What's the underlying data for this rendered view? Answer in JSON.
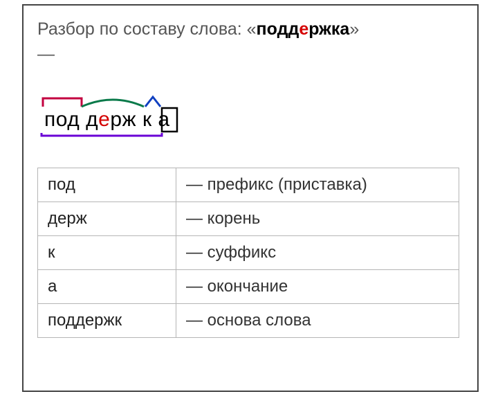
{
  "title": {
    "prefix": "Разбор по составу слова: «",
    "word_pre": "подд",
    "word_hl": "е",
    "word_post": "ржка",
    "suffix": "»",
    "dash": "—"
  },
  "morph": {
    "p1": "под",
    "p2a": "д",
    "p2hl": "е",
    "p2b": "рж",
    "p3": "к",
    "p4": "а"
  },
  "rows": [
    {
      "part": "под",
      "desc": "— префикс (приставка)"
    },
    {
      "part": "держ",
      "desc": "— корень"
    },
    {
      "part": "к",
      "desc": "— суффикс"
    },
    {
      "part": "а",
      "desc": "— окончание"
    },
    {
      "part": "поддержк",
      "desc": "— основа слова"
    }
  ]
}
